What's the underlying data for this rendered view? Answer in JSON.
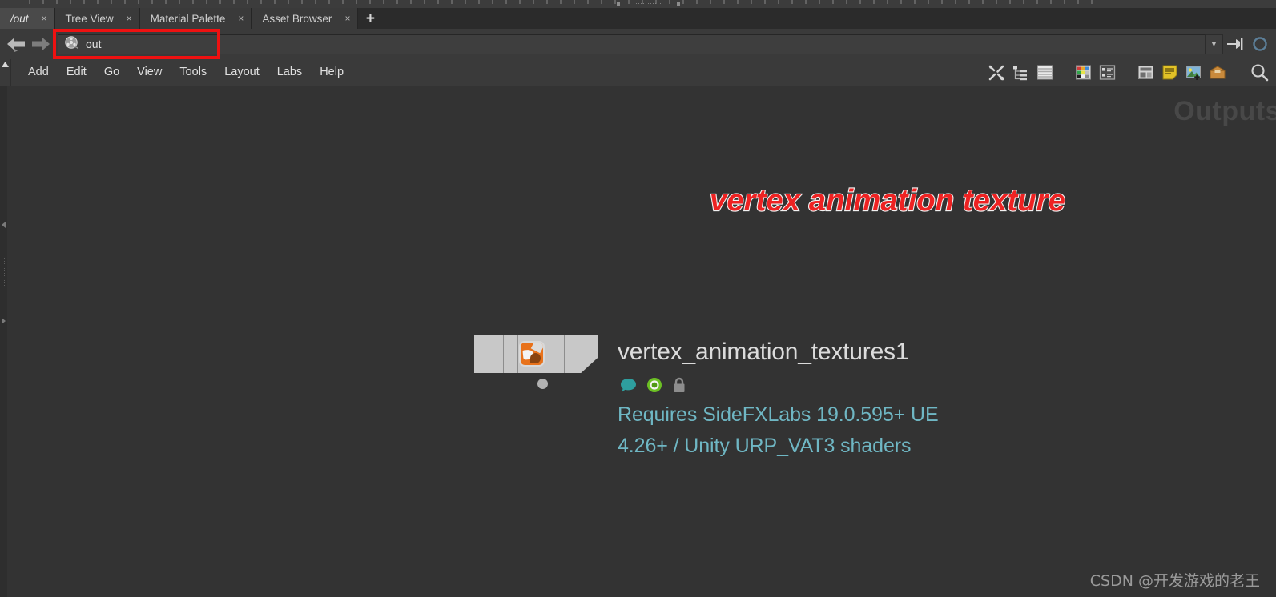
{
  "window": {
    "app_title_bar_visible": true
  },
  "tabs": {
    "items": [
      {
        "label": "/out",
        "active": true,
        "close_glyph": "×"
      },
      {
        "label": "Tree View",
        "active": false,
        "close_glyph": "×"
      },
      {
        "label": "Material Palette",
        "active": false,
        "close_glyph": "×"
      },
      {
        "label": "Asset Browser",
        "active": false,
        "close_glyph": "×"
      }
    ],
    "add_tab_glyph": "+"
  },
  "pathbar": {
    "back_icon": "arrow-left-icon",
    "forward_icon": "arrow-right-icon",
    "node_icon": "film-reel-icon",
    "value": "out",
    "placeholder": "out",
    "dropdown_glyph": "▼",
    "pin_icon": "pin-icon"
  },
  "menubar": {
    "items": [
      {
        "label": "Add"
      },
      {
        "label": "Edit"
      },
      {
        "label": "Go"
      },
      {
        "label": "View"
      },
      {
        "label": "Tools"
      },
      {
        "label": "Layout"
      },
      {
        "label": "Labs"
      },
      {
        "label": "Help"
      }
    ]
  },
  "toolbar": {
    "icons": [
      {
        "name": "tools-wrench-icon"
      },
      {
        "name": "tree-list-icon"
      },
      {
        "name": "layers-icon"
      },
      {
        "name": "color-palette-icon"
      },
      {
        "name": "detail-list-icon"
      },
      {
        "name": "layout-panes-icon"
      },
      {
        "name": "sticky-note-icon"
      },
      {
        "name": "image-add-icon"
      },
      {
        "name": "asset-box-icon"
      },
      {
        "name": "search-icon"
      }
    ]
  },
  "canvas": {
    "watermark_label": "Outputs",
    "headline": "vertex animation texture",
    "headline_color": "#ee2222",
    "headline_stroke_color": "#f2f2f2",
    "background_color": "#333333"
  },
  "node": {
    "name": "vertex_animation_textures1",
    "selected": true,
    "selection_color": "#f2c300",
    "icon_name": "vertex-animation-textures-icon",
    "icon_color": "#e8721b",
    "badges": [
      {
        "name": "comment-badge",
        "label": "comment"
      },
      {
        "name": "display-flag-badge",
        "label": "display"
      },
      {
        "name": "lock-badge",
        "label": "locked"
      }
    ],
    "comment_line1": "Requires SideFXLabs 19.0.595+ UE",
    "comment_line2": "4.26+ / Unity URP_VAT3 shaders",
    "comment_color": "#6fb7c4",
    "output_connector": "output-dot"
  },
  "watermark": {
    "text": "CSDN @开发游戏的老王"
  }
}
